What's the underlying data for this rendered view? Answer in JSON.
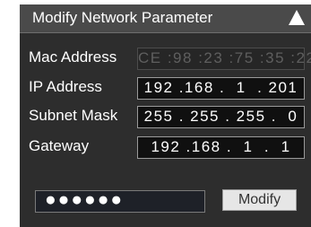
{
  "dialog": {
    "title": "Modify Network Parameter",
    "collapse_icon": "triangle-up-icon"
  },
  "fields": {
    "mac": {
      "label": "Mac Address",
      "value": "CE :98 :23 :75 :35 :22",
      "disabled": true
    },
    "ip": {
      "label": "IP Address",
      "value": "192 .168 .  1  . 201"
    },
    "subnet": {
      "label": "Subnet Mask",
      "value": "255 . 255 . 255 .  0"
    },
    "gateway": {
      "label": "Gateway",
      "value": "192 .168 .  1  .  1"
    }
  },
  "password": {
    "value": "●●●●●●"
  },
  "modify_button": {
    "label": "Modify"
  },
  "colors": {
    "panel_bg": "#2d2d2d",
    "titlebar_bg": "#4a4a4a",
    "field_bg": "#101010",
    "button_bg": "#e6e6e6"
  }
}
